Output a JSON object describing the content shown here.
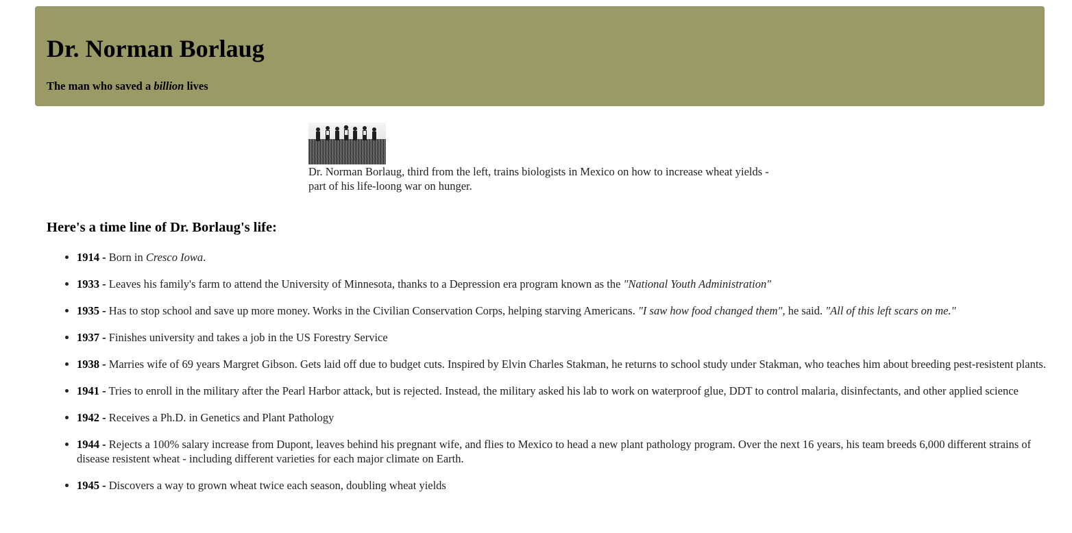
{
  "header": {
    "title": "Dr. Norman Borlaug",
    "subtitle_before": "The man who saved a ",
    "subtitle_emphasis": "billion",
    "subtitle_after": " lives",
    "background_color": "#9a9a66"
  },
  "figure": {
    "caption": "Dr. Norman Borlaug, third from the left, trains biologists in Mexico on how to increase wheat yields - part of his life-loong war on hunger."
  },
  "timeline": {
    "heading": "Here's a time line of Dr. Borlaug's life:",
    "items": [
      {
        "year": "1914 -",
        "t1": " Born in ",
        "q1": "Cresco Iowa",
        "t2": ".",
        "q2": "",
        "t3": "",
        "q3": ""
      },
      {
        "year": "1933 -",
        "t1": " Leaves his family's farm to attend the University of Minnesota, thanks to a Depression era program known as the ",
        "q1": "\"National Youth Administration\"",
        "t2": "",
        "q2": "",
        "t3": "",
        "q3": ""
      },
      {
        "year": "1935 -",
        "t1": " Has to stop school and save up more money. Works in the Civilian Conservation Corps, helping starving Americans. ",
        "q1": "\"I saw how food changed them\",",
        "t2": " he said. ",
        "q2": "\"All of this left scars on me.\"",
        "t3": "",
        "q3": ""
      },
      {
        "year": "1937 -",
        "t1": " Finishes university and takes a job in the US Forestry Service",
        "q1": "",
        "t2": "",
        "q2": "",
        "t3": "",
        "q3": ""
      },
      {
        "year": "1938 -",
        "t1": " Marries wife of 69 years Margret Gibson. Gets laid off due to budget cuts. Inspired by Elvin Charles Stakman, he returns to school study under Stakman, who teaches him about breeding pest-resistent plants.",
        "q1": "",
        "t2": "",
        "q2": "",
        "t3": "",
        "q3": ""
      },
      {
        "year": "1941 -",
        "t1": " Tries to enroll in the military after the Pearl Harbor attack, but is rejected. Instead, the military asked his lab to work on waterproof glue, DDT to control malaria, disinfectants, and other applied science",
        "q1": "",
        "t2": "",
        "q2": "",
        "t3": "",
        "q3": ""
      },
      {
        "year": "1942 -",
        "t1": " Receives a Ph.D. in Genetics and Plant Pathology",
        "q1": "",
        "t2": "",
        "q2": "",
        "t3": "",
        "q3": ""
      },
      {
        "year": "1944 -",
        "t1": " Rejects a 100% salary increase from Dupont, leaves behind his pregnant wife, and flies to Mexico to head a new plant pathology program. Over the next 16 years, his team breeds 6,000 different strains of disease resistent wheat - including different varieties for each major climate on Earth.",
        "q1": "",
        "t2": "",
        "q2": "",
        "t3": "",
        "q3": ""
      },
      {
        "year": "1945 -",
        "t1": " Discovers a way to grown wheat twice each season, doubling wheat yields",
        "q1": "",
        "t2": "",
        "q2": "",
        "t3": "",
        "q3": ""
      }
    ]
  }
}
